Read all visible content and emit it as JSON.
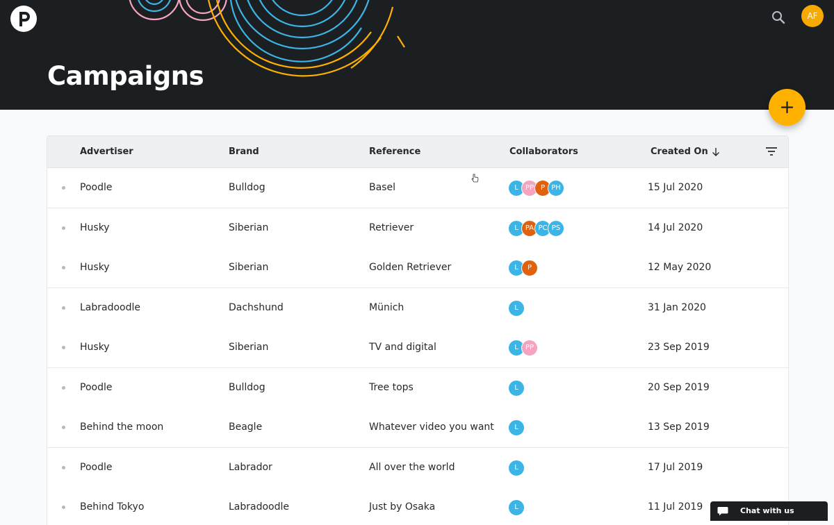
{
  "header": {
    "title": "Campaigns",
    "user_initials": "AF",
    "logo_icon": "brand-logo-icon",
    "search_icon": "search-icon",
    "fab_icon": "plus-icon"
  },
  "colors": {
    "header_bg": "#1c1f21",
    "accent": "#ffb100",
    "avatar_blue": "#3cb4e5",
    "avatar_pink": "#f4a3c1",
    "avatar_orange": "#e0610e"
  },
  "table": {
    "columns": [
      {
        "label": "Advertiser"
      },
      {
        "label": "Brand"
      },
      {
        "label": "Reference"
      },
      {
        "label": "Collaborators"
      },
      {
        "label": "Created On",
        "sorted": "descending"
      }
    ],
    "rows": [
      {
        "advertiser": "Poodle",
        "brand": "Bulldog",
        "reference": "Basel",
        "collaborators": [
          {
            "initials": "L",
            "color": "#3cb4e5"
          },
          {
            "initials": "PP",
            "color": "#f4a3c1"
          },
          {
            "initials": "P",
            "color": "#e0610e"
          },
          {
            "initials": "PH",
            "color": "#3cb4e5"
          }
        ],
        "created_on": "15 Jul 2020"
      },
      {
        "advertiser": "Husky",
        "brand": "Siberian",
        "reference": "Retriever",
        "collaborators": [
          {
            "initials": "L",
            "color": "#3cb4e5"
          },
          {
            "initials": "PA",
            "color": "#e0610e"
          },
          {
            "initials": "PC",
            "color": "#3cb4e5"
          },
          {
            "initials": "PS",
            "color": "#3cb4e5"
          }
        ],
        "created_on": "14 Jul 2020"
      },
      {
        "advertiser": "Husky",
        "brand": "Siberian",
        "reference": "Golden Retriever",
        "collaborators": [
          {
            "initials": "L",
            "color": "#3cb4e5"
          },
          {
            "initials": "P",
            "color": "#e0610e"
          }
        ],
        "created_on": "12 May 2020"
      },
      {
        "advertiser": "Labradoodle",
        "brand": "Dachshund",
        "reference": "Münich",
        "collaborators": [
          {
            "initials": "L",
            "color": "#3cb4e5"
          }
        ],
        "created_on": "31 Jan 2020"
      },
      {
        "advertiser": "Husky",
        "brand": "Siberian",
        "reference": "TV and digital",
        "collaborators": [
          {
            "initials": "L",
            "color": "#3cb4e5"
          },
          {
            "initials": "PP",
            "color": "#f4a3c1"
          }
        ],
        "created_on": "23 Sep 2019"
      },
      {
        "advertiser": "Poodle",
        "brand": "Bulldog",
        "reference": "Tree tops",
        "collaborators": [
          {
            "initials": "L",
            "color": "#3cb4e5"
          }
        ],
        "created_on": "20 Sep 2019"
      },
      {
        "advertiser": "Behind the moon",
        "brand": "Beagle",
        "reference": "Whatever video you want",
        "collaborators": [
          {
            "initials": "L",
            "color": "#3cb4e5"
          }
        ],
        "created_on": "13 Sep 2019"
      },
      {
        "advertiser": "Poodle",
        "brand": "Labrador",
        "reference": "All over the world",
        "collaborators": [
          {
            "initials": "L",
            "color": "#3cb4e5"
          }
        ],
        "created_on": "17 Jul 2019"
      },
      {
        "advertiser": "Behind Tokyo",
        "brand": "Labradoodle",
        "reference": "Just by Osaka",
        "collaborators": [
          {
            "initials": "L",
            "color": "#3cb4e5"
          }
        ],
        "created_on": "11 Jul 2019"
      }
    ]
  },
  "chat": {
    "label": "Chat with us"
  }
}
